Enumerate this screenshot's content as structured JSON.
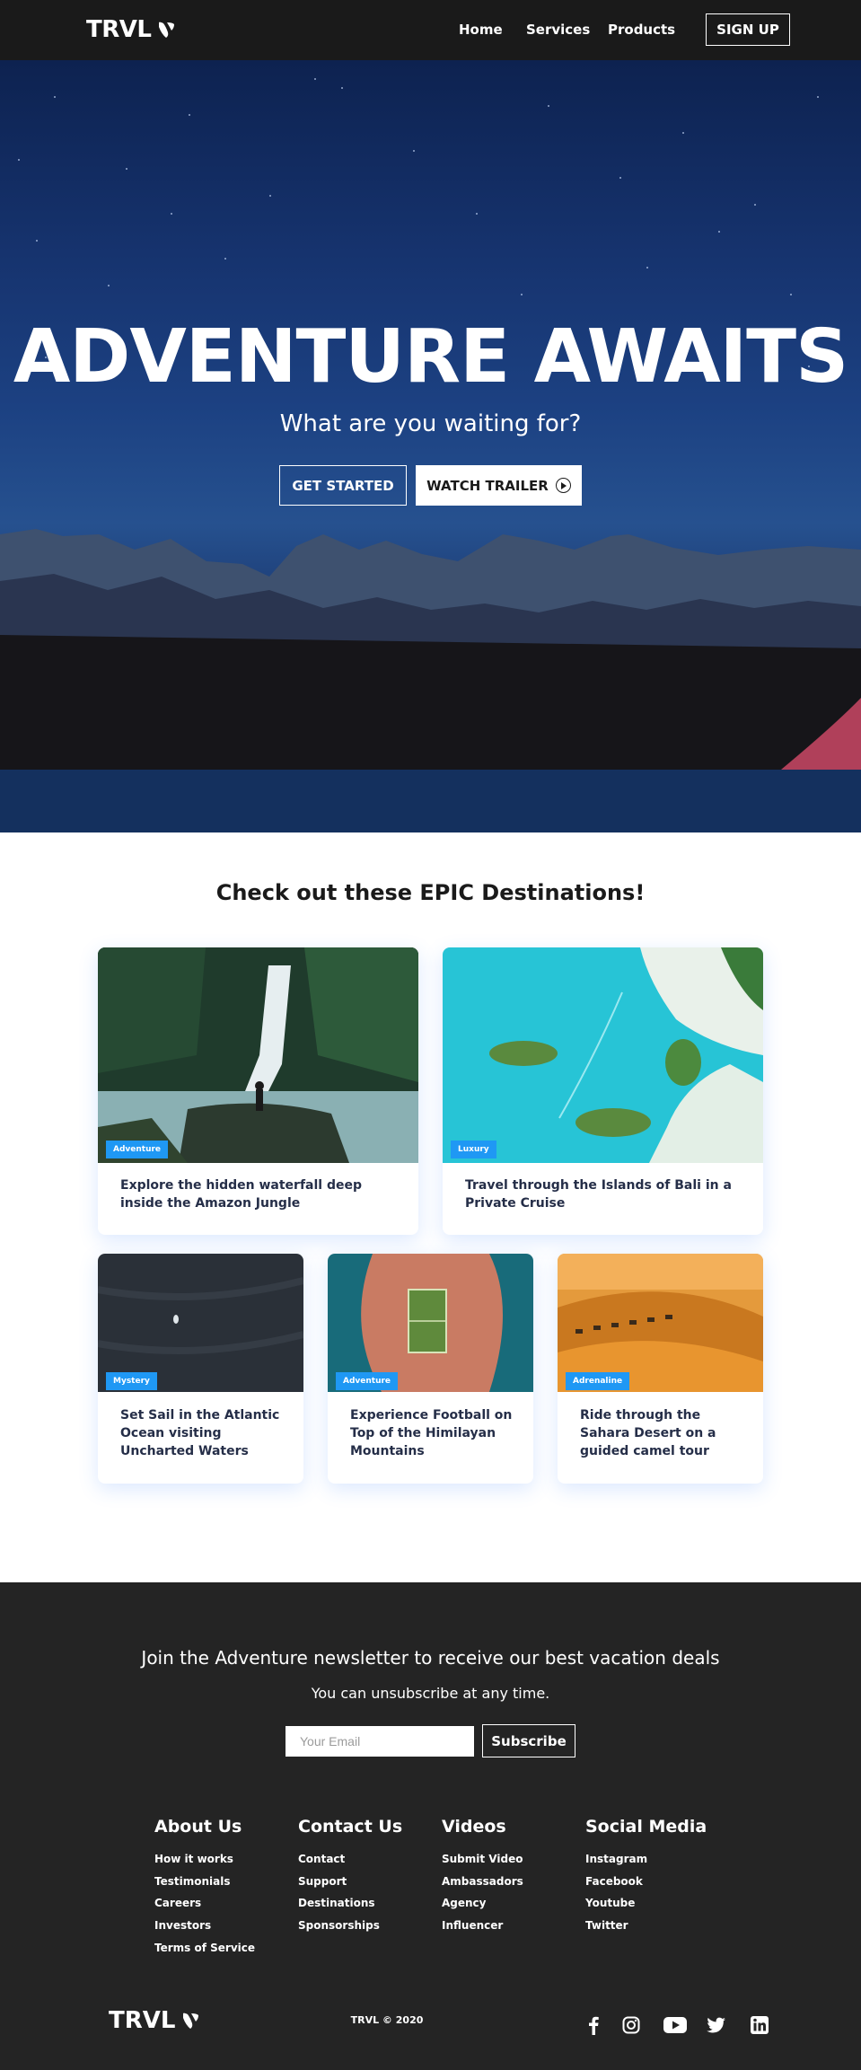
{
  "navbar": {
    "logo_text": "TRVL",
    "links": [
      "Home",
      "Services",
      "Products"
    ],
    "signup_label": "SIGN UP"
  },
  "hero": {
    "title": "ADVENTURE AWAITS",
    "subtitle": "What are you waiting for?",
    "get_started_label": "GET STARTED",
    "watch_trailer_label": "WATCH TRAILER"
  },
  "destinations": {
    "heading": "Check out these EPIC Destinations!",
    "cards": [
      {
        "tag": "Adventure",
        "text": "Explore the hidden waterfall deep inside the Amazon Jungle"
      },
      {
        "tag": "Luxury",
        "text": "Travel through the Islands of Bali in a Private Cruise"
      },
      {
        "tag": "Mystery",
        "text": "Set Sail in the Atlantic Ocean visiting Uncharted Waters"
      },
      {
        "tag": "Adventure",
        "text": "Experience Football on Top of the Himilayan Mountains"
      },
      {
        "tag": "Adrenaline",
        "text": "Ride through the Sahara Desert on a guided camel tour"
      }
    ]
  },
  "newsletter": {
    "title": "Join the Adventure newsletter to receive our best vacation deals",
    "subtitle": "You can unsubscribe at any time.",
    "email_placeholder": "Your Email",
    "subscribe_label": "Subscribe"
  },
  "footer": {
    "columns": [
      {
        "title": "About Us",
        "links": [
          "How it works",
          "Testimonials",
          "Careers",
          "Investors",
          "Terms of Service"
        ]
      },
      {
        "title": "Contact Us",
        "links": [
          "Contact",
          "Support",
          "Destinations",
          "Sponsorships"
        ]
      },
      {
        "title": "Videos",
        "links": [
          "Submit Video",
          "Ambassadors",
          "Agency",
          "Influencer"
        ]
      },
      {
        "title": "Social Media",
        "links": [
          "Instagram",
          "Facebook",
          "Youtube",
          "Twitter"
        ]
      }
    ],
    "logo_text": "TRVL",
    "copyright": "TRVL © 2020",
    "social_icons": [
      "facebook-icon",
      "instagram-icon",
      "youtube-icon",
      "twitter-icon",
      "linkedin-icon"
    ]
  }
}
